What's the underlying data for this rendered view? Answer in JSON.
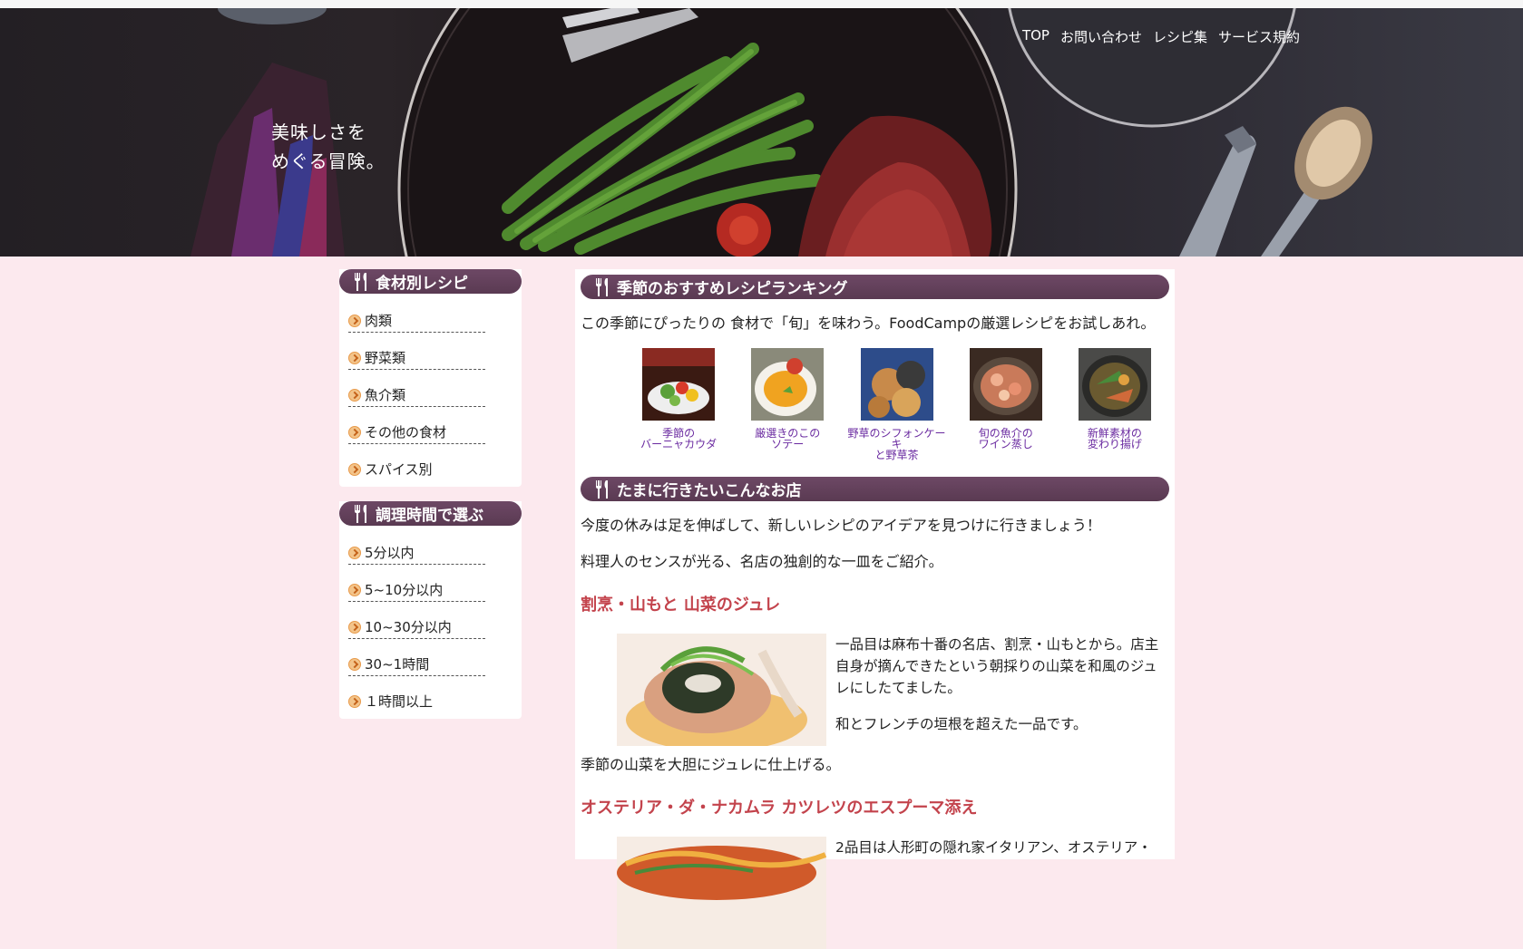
{
  "hero": {
    "tagline_1": "美味しさを",
    "tagline_2": "めぐる冒険。"
  },
  "nav": [
    "TOP",
    "お問い合わせ",
    "レシピ集",
    "サービス規約"
  ],
  "sidebar": {
    "ingredients": {
      "title": "食材別レシピ",
      "items": [
        "肉類",
        "野菜類",
        "魚介類",
        "その他の食材",
        "スパイス別"
      ]
    },
    "time": {
      "title": "調理時間で選ぶ",
      "items": [
        "5分以内",
        "5~10分以内",
        "10~30分以内",
        "30~1時間",
        "１時間以上"
      ]
    }
  },
  "ranking": {
    "title": "季節のおすすめレシピランキング",
    "intro": "この季節にぴったりの 食材で「旬」を味わう。FoodCampの厳選レシピをお試しあれ。",
    "items": [
      {
        "l1": "季節の",
        "l2": "バーニャカウダ",
        "l3": ""
      },
      {
        "l1": "厳選きのこの",
        "l2": "ソテー",
        "l3": ""
      },
      {
        "l1": "野草のシフォンケー",
        "l2": "キ",
        "l3": "と野草茶"
      },
      {
        "l1": "旬の魚介の",
        "l2": "ワイン蒸し",
        "l3": ""
      },
      {
        "l1": "新鮮素材の",
        "l2": "変わり揚げ",
        "l3": ""
      }
    ]
  },
  "shops": {
    "title": "たまに行きたいこんなお店",
    "p1": "今度の休みは足を伸ばして、新しいレシピのアイデアを見つけに行きましょう！",
    "p2": "料理人のセンスが光る、名店の独創的な一皿をご紹介。",
    "shop1": {
      "title": "割烹・山もと 山菜のジュレ",
      "desc_1": "一品目は麻布十番の名店、割烹・山もとから。店主",
      "desc_2": "自身が摘んできたという朝採りの山菜を和風のジュ",
      "desc_3": "レにしたてました。",
      "desc_4": "和とフレンチの垣根を超えた一品です。",
      "caption": "季節の山菜を大胆にジュレに仕上げる。"
    },
    "shop2": {
      "title": "オステリア・ダ・ナカムラ カツレツのエスプーマ添え",
      "desc_1": "2品目は人形町の隠れ家イタリアン、オステリア・"
    }
  },
  "colors": {
    "background": "#fce9ee",
    "heading_bar": "#5a3a52",
    "shop_title": "#c3434c",
    "thumb_caption": "#6a2aa0"
  }
}
